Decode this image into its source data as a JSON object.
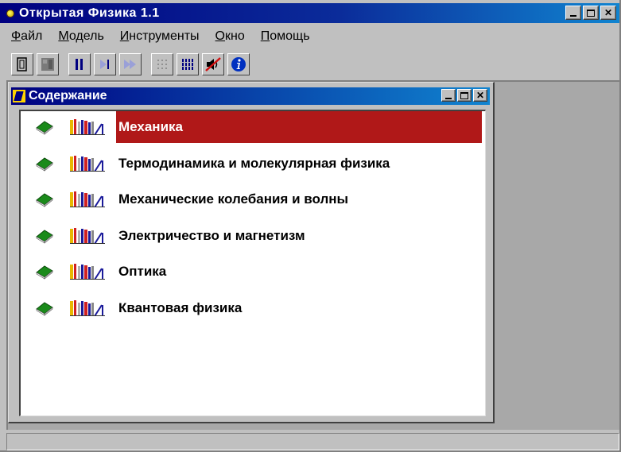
{
  "window": {
    "title": "Открытая Физика 1.1"
  },
  "menu": [
    "Файл",
    "Модель",
    "Инструменты",
    "Окно",
    "Помощь"
  ],
  "toolbar": [
    {
      "icon": "exit-icon",
      "enabled": true
    },
    {
      "icon": "run-icon",
      "enabled": false
    },
    {
      "icon": "pause-icon",
      "enabled": true
    },
    {
      "icon": "step-icon",
      "enabled": true
    },
    {
      "icon": "fast-forward-icon",
      "enabled": true
    },
    {
      "icon": "grid-sparse-icon",
      "enabled": false
    },
    {
      "icon": "grid-dense-icon",
      "enabled": true
    },
    {
      "icon": "sound-off-icon",
      "enabled": true
    },
    {
      "icon": "info-icon",
      "enabled": true
    }
  ],
  "contents_window": {
    "title": "Содержание",
    "topics": [
      {
        "label": "Механика",
        "selected": true
      },
      {
        "label": "Термодинамика и молекулярная физика",
        "selected": false
      },
      {
        "label": "Механические колебания и волны",
        "selected": false
      },
      {
        "label": "Электричество и магнетизм",
        "selected": false
      },
      {
        "label": "Оптика",
        "selected": false
      },
      {
        "label": "Квантовая физика",
        "selected": false
      }
    ]
  },
  "colors": {
    "titlebar": "#000080",
    "selection": "#b01818",
    "book": "#1a8a1a"
  }
}
